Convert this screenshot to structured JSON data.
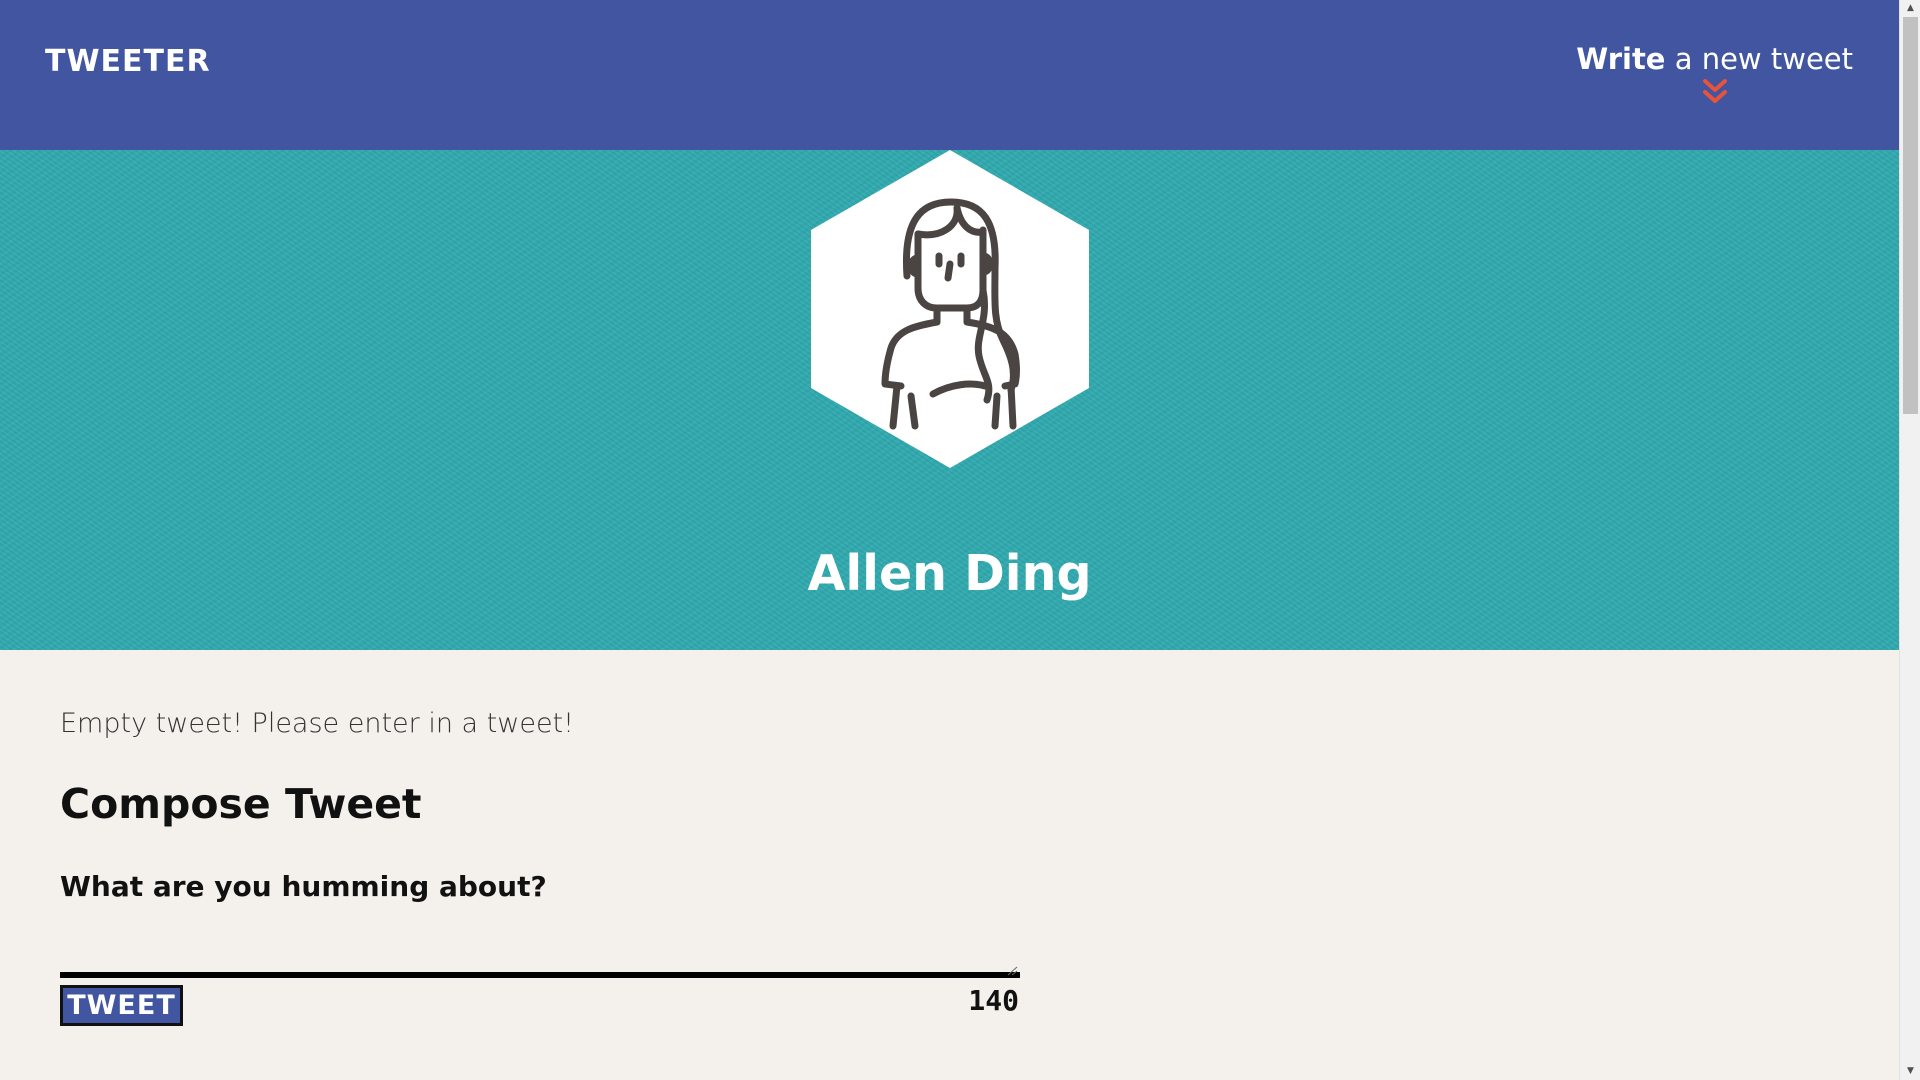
{
  "nav": {
    "brand": "TWEETER",
    "compose_bold": "Write",
    "compose_rest": " a new tweet",
    "chevron_icon": "double-chevron-down-icon",
    "accent": "#e8533a"
  },
  "profile": {
    "name": "Allen Ding",
    "avatar_icon": "woman-avatar-icon"
  },
  "compose": {
    "error": "Empty tweet! Please enter in a tweet!",
    "title": "Compose Tweet",
    "label": "What are you humming about?",
    "value": "",
    "submit_label": "TWEET",
    "counter": "140"
  },
  "colors": {
    "nav": "#4155a1",
    "hero": "#2fa9ad",
    "page": "#f4f1ec"
  }
}
